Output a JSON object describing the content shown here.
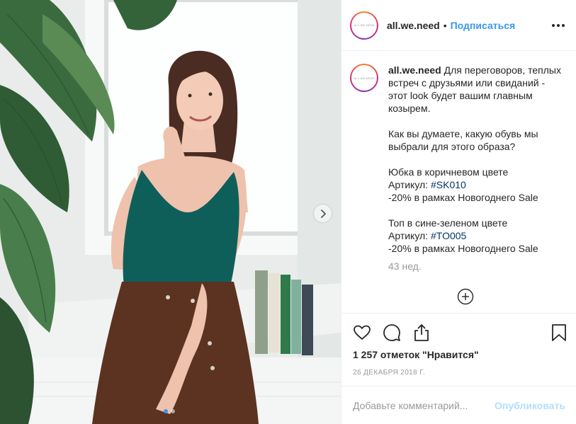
{
  "post": {
    "username": "all.we.need",
    "avatar_text": "ALL.WE.NEED",
    "separator": "•",
    "follow_label": "Подписаться",
    "caption": {
      "line1": "Для переговоров, теплых встреч с друзьями или свиданий - этот look будет вашим главным козырем.",
      "line2": "Как вы думаете, какую обувь мы выбрали для этого образа?",
      "item1_title": "Юбка в коричневом цвете",
      "item1_article_label": "Артикул: ",
      "item1_hashtag": "#SK010",
      "item1_discount": "-20% в рамках Новогоднего Sale",
      "item2_title": "Топ в сине-зеленом цвете",
      "item2_article_label": "Артикул: ",
      "item2_hashtag": "#TO005",
      "item2_discount": "-20% в рамках Новогоднего Sale"
    },
    "time_ago": "43 нед.",
    "likes": "1 257 отметок \"Нравится\"",
    "date": "26 ДЕКАБРЯ 2018 Г.",
    "comment_placeholder": "Добавьте комментарий...",
    "publish_label": "Опубликовать"
  },
  "carousel": {
    "current": 1,
    "total": 2
  },
  "icons": {
    "like": "heart-icon",
    "comment": "comment-icon",
    "share": "share-icon",
    "save": "bookmark-icon",
    "more": "more-options-icon",
    "next": "chevron-right-icon",
    "load_more": "plus-circle-icon"
  },
  "colors": {
    "link": "#3897f0",
    "hashtag": "#003569",
    "muted": "#999999",
    "publish_disabled": "#b2dffc"
  }
}
